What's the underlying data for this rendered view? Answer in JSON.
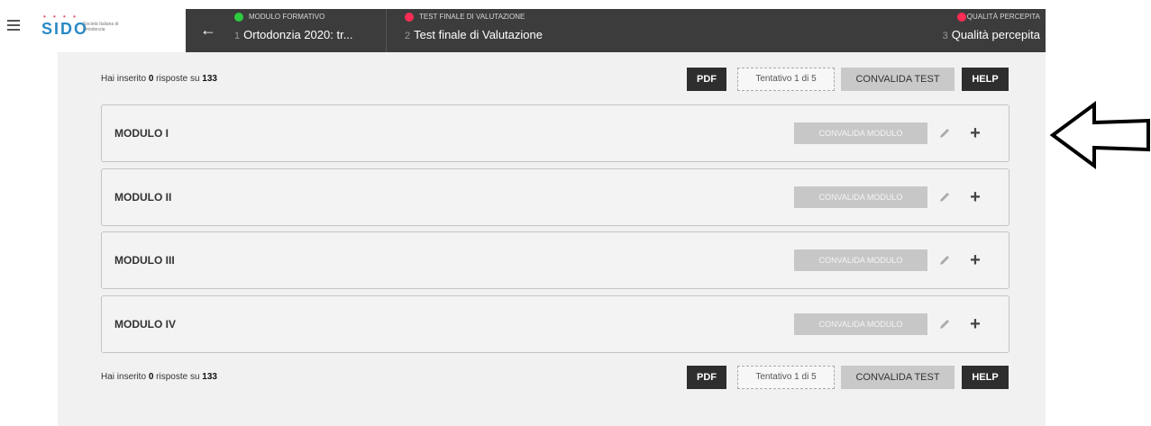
{
  "header": {
    "logo_text": "SIDO",
    "logo_dots": "• • • •",
    "logo_subtitle": "Società Italiana di Ortodonzia",
    "steps": [
      {
        "number": "1",
        "category": "MODULO FORMATIVO",
        "title": "Ortodonzia 2020: tr...",
        "status_color": "#2ecc40"
      },
      {
        "number": "2",
        "category": "TEST FINALE DI VALUTAZIONE",
        "title": "Test finale di Valutazione",
        "status_color": "#ff2d55"
      },
      {
        "number": "3",
        "category": "QUALITÀ PERCEPITA",
        "title": "Qualità percepita",
        "status_color": "#ff2d55"
      }
    ]
  },
  "summary": {
    "prefix": "Hai inserito ",
    "answered": "0",
    "middle": " risposte su ",
    "total": "133",
    "pdf_label": "PDF",
    "attempt_label": "Tentativo 1 di 5",
    "validate_test_label": "CONVALIDA TEST",
    "help_label": "HELP"
  },
  "modules": [
    {
      "title": "MODULO I",
      "validate_label": "CONVALIDA MODULO"
    },
    {
      "title": "MODULO II",
      "validate_label": "CONVALIDA MODULO"
    },
    {
      "title": "MODULO III",
      "validate_label": "CONVALIDA MODULO"
    },
    {
      "title": "MODULO IV",
      "validate_label": "CONVALIDA MODULO"
    }
  ]
}
